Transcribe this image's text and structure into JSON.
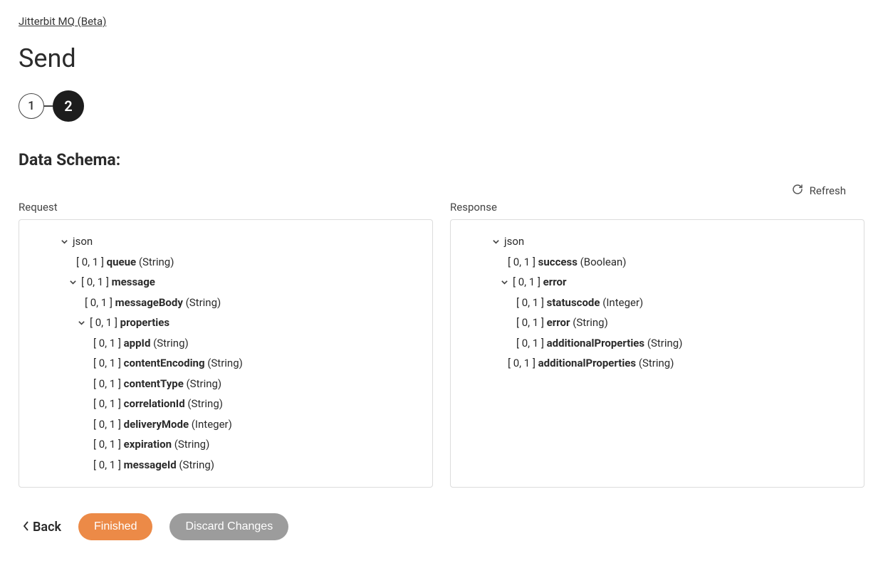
{
  "breadcrumb": "Jitterbit MQ (Beta)",
  "page_title": "Send",
  "stepper": {
    "step1": "1",
    "step2": "2"
  },
  "section_title": "Data Schema:",
  "refresh_label": "Refresh",
  "request_label": "Request",
  "response_label": "Response",
  "request_tree": [
    {
      "indent": 0,
      "chevron": true,
      "prefix": "",
      "name": "json",
      "type": ""
    },
    {
      "indent": 1,
      "chevron": false,
      "prefix": "[ 0, 1 ] ",
      "name": "queue",
      "type": " (String)"
    },
    {
      "indent": 1,
      "chevron": true,
      "prefix": "[ 0, 1 ] ",
      "name": "message",
      "type": ""
    },
    {
      "indent": 2,
      "chevron": false,
      "prefix": "[ 0, 1 ] ",
      "name": "messageBody",
      "type": " (String)"
    },
    {
      "indent": 2,
      "chevron": true,
      "prefix": "[ 0, 1 ] ",
      "name": "properties",
      "type": ""
    },
    {
      "indent": 3,
      "chevron": false,
      "prefix": "[ 0, 1 ] ",
      "name": "appId",
      "type": " (String)"
    },
    {
      "indent": 3,
      "chevron": false,
      "prefix": "[ 0, 1 ] ",
      "name": "contentEncoding",
      "type": " (String)"
    },
    {
      "indent": 3,
      "chevron": false,
      "prefix": "[ 0, 1 ] ",
      "name": "contentType",
      "type": " (String)"
    },
    {
      "indent": 3,
      "chevron": false,
      "prefix": "[ 0, 1 ] ",
      "name": "correlationId",
      "type": " (String)"
    },
    {
      "indent": 3,
      "chevron": false,
      "prefix": "[ 0, 1 ] ",
      "name": "deliveryMode",
      "type": " (Integer)"
    },
    {
      "indent": 3,
      "chevron": false,
      "prefix": "[ 0, 1 ] ",
      "name": "expiration",
      "type": " (String)"
    },
    {
      "indent": 3,
      "chevron": false,
      "prefix": "[ 0, 1 ] ",
      "name": "messageId",
      "type": " (String)"
    }
  ],
  "response_tree": [
    {
      "indent": 0,
      "chevron": true,
      "prefix": "",
      "name": "json",
      "type": ""
    },
    {
      "indent": 1,
      "chevron": false,
      "prefix": "[ 0, 1 ] ",
      "name": "success",
      "type": " (Boolean)"
    },
    {
      "indent": 1,
      "chevron": true,
      "prefix": "[ 0, 1 ] ",
      "name": "error",
      "type": ""
    },
    {
      "indent": 2,
      "chevron": false,
      "prefix": "[ 0, 1 ] ",
      "name": "statuscode",
      "type": " (Integer)"
    },
    {
      "indent": 2,
      "chevron": false,
      "prefix": "[ 0, 1 ] ",
      "name": "error",
      "type": " (String)"
    },
    {
      "indent": 2,
      "chevron": false,
      "prefix": "[ 0, 1 ] ",
      "name": "additionalProperties",
      "type": " (String)"
    },
    {
      "indent": 1,
      "chevron": false,
      "prefix": "[ 0, 1 ] ",
      "name": "additionalProperties",
      "type": " (String)"
    }
  ],
  "footer": {
    "back": "Back",
    "finished": "Finished",
    "discard": "Discard Changes"
  }
}
